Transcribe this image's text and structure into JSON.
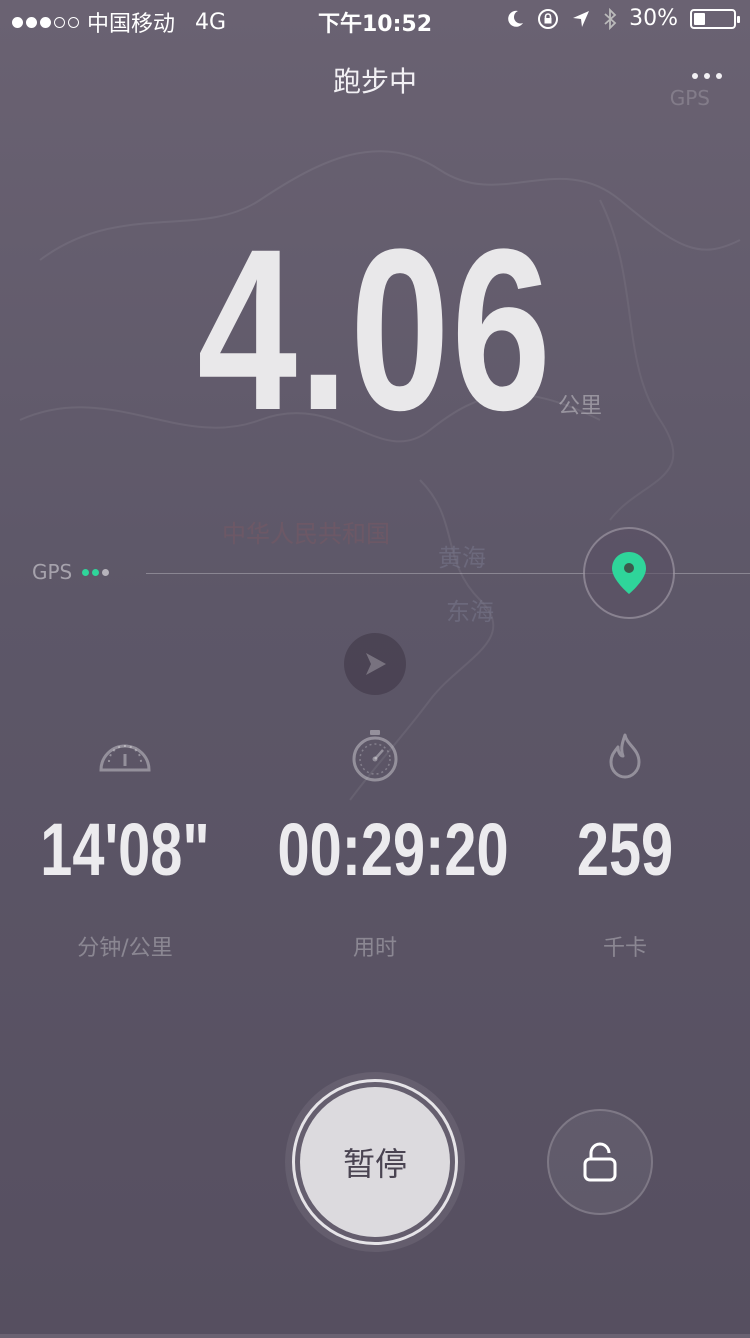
{
  "status_bar": {
    "carrier": "中国移动",
    "network": "4G",
    "time": "下午10:52",
    "battery": "30%",
    "battery_level": 0.3
  },
  "nav": {
    "title": "跑步中",
    "gps_hint": "GPS"
  },
  "distance": {
    "value": "4.06",
    "unit": "公里"
  },
  "gps": {
    "label": "GPS"
  },
  "map_labels": {
    "country": "中华人民共和国",
    "sea1": "黄海",
    "sea2": "东海"
  },
  "stats": [
    {
      "icon": "speedometer-icon",
      "value": "14'08\"",
      "label": "分钟/公里"
    },
    {
      "icon": "stopwatch-icon",
      "value": "00:29:20",
      "label": "用时"
    },
    {
      "icon": "flame-icon",
      "value": "259",
      "label": "千卡"
    }
  ],
  "controls": {
    "pause_label": "暂停"
  },
  "colors": {
    "accent_green": "#2fd59a"
  }
}
